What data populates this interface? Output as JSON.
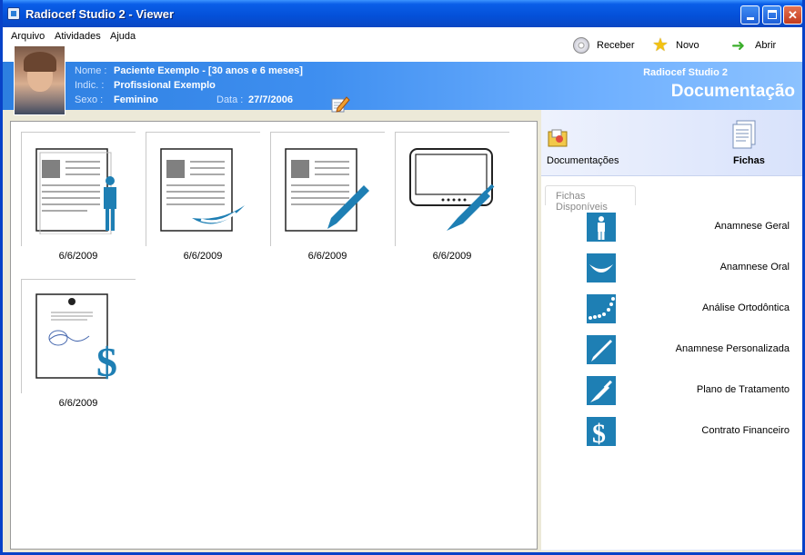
{
  "window": {
    "title": "Radiocef Studio 2 - Viewer"
  },
  "menu": {
    "items": [
      "Arquivo",
      "Atividades",
      "Ajuda"
    ]
  },
  "toolbar": {
    "receber": "Receber",
    "novo": "Novo",
    "abrir": "Abrir"
  },
  "patient": {
    "nome_label": "Nome :",
    "nome": "Paciente Exemplo - [30 anos e 6 meses]",
    "indic_label": "Indic. :",
    "indic": "Profissional Exemplo",
    "sexo_label": "Sexo :",
    "sexo": "Feminino",
    "data_label": "Data :",
    "data": "27/7/2006"
  },
  "header": {
    "brand": "Radiocef Studio 2",
    "section": "Documentação"
  },
  "documents": [
    {
      "icon": "anamnese-geral-icon",
      "date": "6/6/2009"
    },
    {
      "icon": "anamnese-oral-icon",
      "date": "6/6/2009"
    },
    {
      "icon": "anamnese-personalizada-icon",
      "date": "6/6/2009"
    },
    {
      "icon": "plano-tratamento-icon",
      "date": "6/6/2009"
    },
    {
      "icon": "contrato-financeiro-icon",
      "date": "6/6/2009"
    }
  ],
  "tabs": {
    "documentacoes": "Documentações",
    "fichas": "Fichas"
  },
  "fichas": {
    "section_title": "Fichas Disponíveis",
    "items": [
      {
        "label": "Anamnese Geral",
        "icon": "person-icon"
      },
      {
        "label": "Anamnese Oral",
        "icon": "smile-icon"
      },
      {
        "label": "Análise Ortodôntica",
        "icon": "braces-icon"
      },
      {
        "label": "Anamnese Personalizada",
        "icon": "pen-icon"
      },
      {
        "label": "Plano de Tratamento",
        "icon": "syringe-icon"
      },
      {
        "label": "Contrato Financeiro",
        "icon": "dollar-icon"
      }
    ]
  },
  "colors": {
    "title_bar": "#0450d8",
    "header_gradient_start": "#2d7fe0",
    "icon_blue": "#1e7fb4"
  }
}
